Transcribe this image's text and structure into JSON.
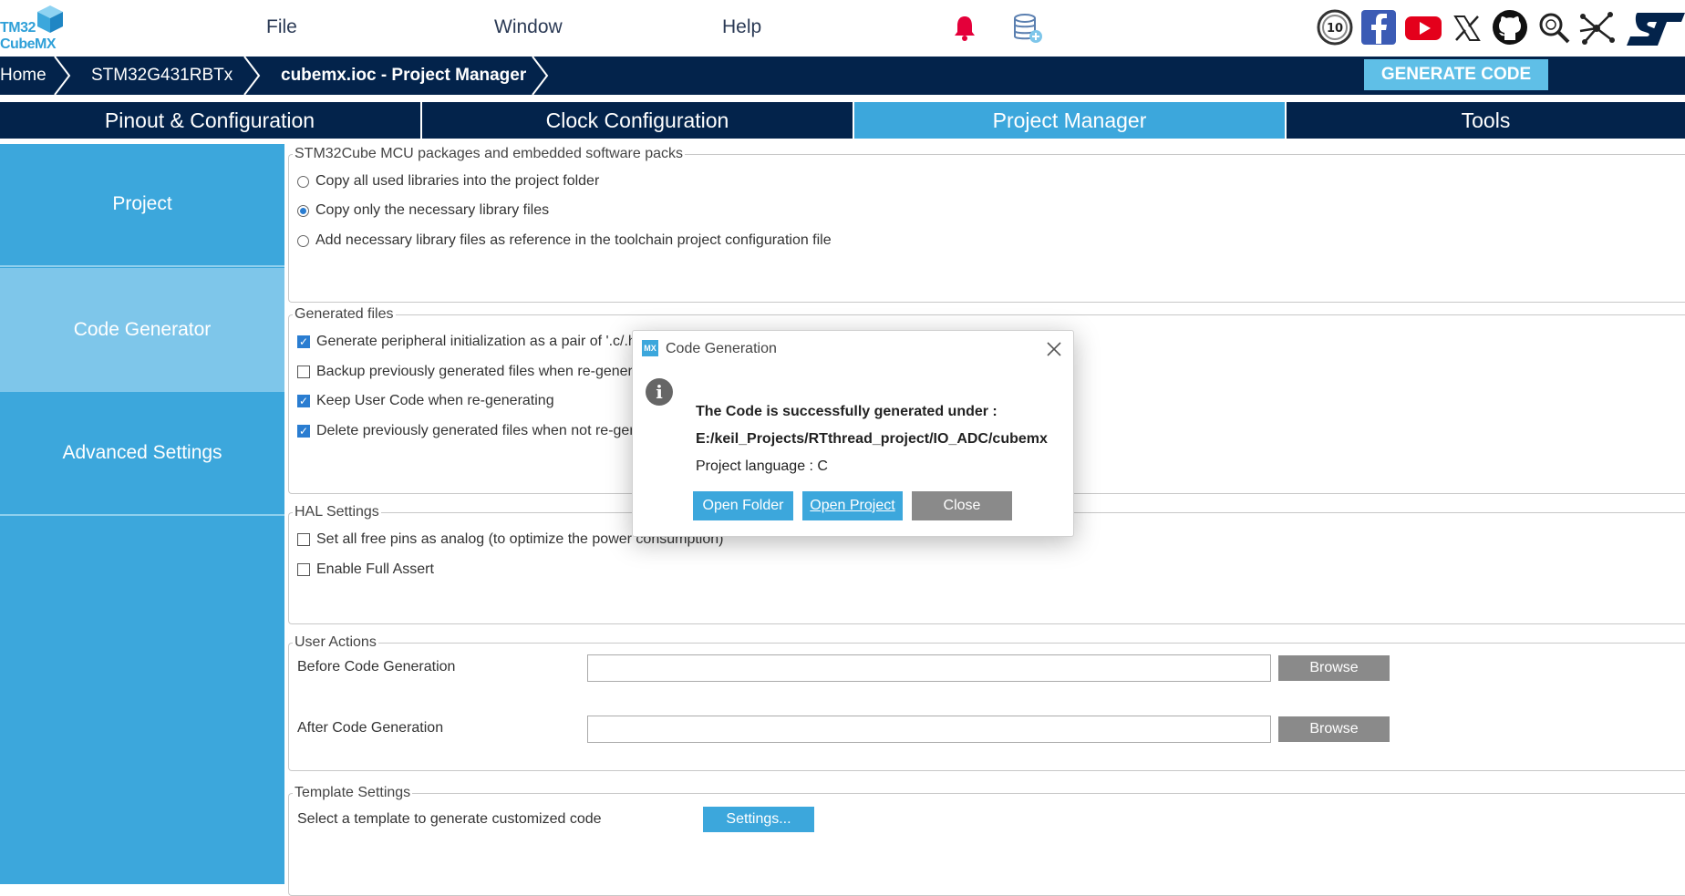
{
  "app": {
    "logo_line1": "TM32",
    "logo_line2": "CubeMX"
  },
  "menu": {
    "file": "File",
    "window": "Window",
    "help": "Help"
  },
  "breadcrumb": {
    "items": [
      "Home",
      "STM32G431RBTx",
      "cubemx.ioc - Project Manager"
    ],
    "generate_button": "GENERATE CODE"
  },
  "tabs": [
    {
      "label": "Pinout & Configuration",
      "active": false
    },
    {
      "label": "Clock Configuration",
      "active": false
    },
    {
      "label": "Project Manager",
      "active": true
    },
    {
      "label": "Tools",
      "active": false
    }
  ],
  "sidebar": {
    "items": [
      {
        "label": "Project",
        "active": false
      },
      {
        "label": "Code Generator",
        "active": true
      },
      {
        "label": "Advanced Settings",
        "active": false
      }
    ]
  },
  "packages": {
    "title": "STM32Cube MCU packages and embedded software packs",
    "options": [
      {
        "label": "Copy all used libraries into the project folder",
        "selected": false
      },
      {
        "label": "Copy only the necessary library files",
        "selected": true
      },
      {
        "label": "Add necessary library files as reference in the toolchain project configuration file",
        "selected": false
      }
    ]
  },
  "generated_files": {
    "title": "Generated files",
    "options": [
      {
        "label": "Generate peripheral initialization as a pair of '.c/.h' files per peripheral",
        "checked": true
      },
      {
        "label": "Backup previously generated files when re-generating",
        "checked": false
      },
      {
        "label": "Keep User Code when re-generating",
        "checked": true
      },
      {
        "label": "Delete previously generated files when not re-generated",
        "checked": true
      }
    ]
  },
  "hal": {
    "title": "HAL Settings",
    "options": [
      {
        "label": "Set all free pins as analog (to optimize the power consumption)",
        "checked": false
      },
      {
        "label": "Enable Full Assert",
        "checked": false
      }
    ]
  },
  "user_actions": {
    "title": "User Actions",
    "before_label": "Before Code Generation",
    "before_value": "",
    "after_label": "After Code Generation",
    "after_value": "",
    "browse_label": "Browse"
  },
  "template": {
    "title": "Template Settings",
    "label": "Select a template to generate customized code",
    "button": "Settings..."
  },
  "dialog": {
    "icon_text": "MX",
    "title": "Code Generation",
    "message": "The Code is successfully generated under :",
    "path": "E:/keil_Projects/RTthread_project/IO_ADC/cubemx",
    "language": "Project language : C",
    "buttons": {
      "open_folder": "Open Folder",
      "open_project": "Open Project",
      "close": "Close"
    }
  },
  "colors": {
    "navy": "#03234b",
    "accent": "#3ca7dc",
    "accent_light": "#7ec6ea",
    "bell": "#e4003a"
  }
}
